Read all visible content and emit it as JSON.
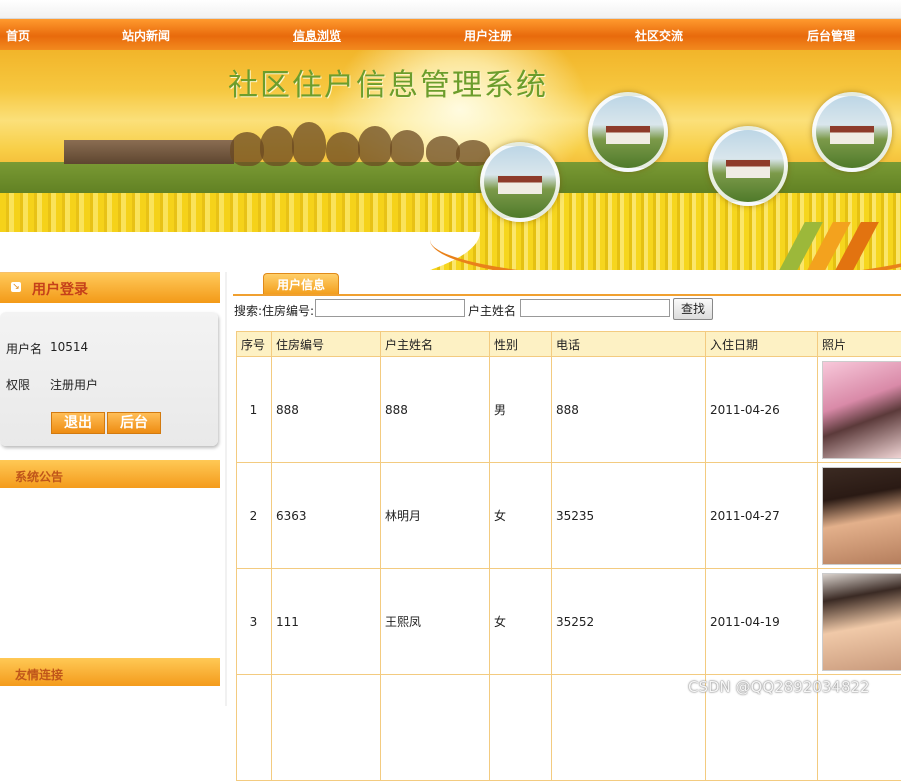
{
  "nav": [
    {
      "label": "首页"
    },
    {
      "label": "站内新闻"
    },
    {
      "label": "信息浏览",
      "active": true
    },
    {
      "label": "用户注册"
    },
    {
      "label": "社区交流"
    },
    {
      "label": "后台管理"
    }
  ],
  "banner": {
    "title": "社区住户信息管理系统"
  },
  "sidebar": {
    "login_title": "用户登录",
    "username_label": "用户名",
    "username_value": "10514",
    "role_label": "权限",
    "role_value": "注册用户",
    "logout_label": "退出",
    "admin_label": "后台",
    "notice_title": "系统公告",
    "links_title": "友情连接"
  },
  "main": {
    "tab_label": "用户信息",
    "search": {
      "label1": "搜索:住房编号:",
      "label2": "户主姓名",
      "button": "查找",
      "house_value": "",
      "name_value": ""
    },
    "table": {
      "headers": [
        "序号",
        "住房编号",
        "户主姓名",
        "性别",
        "电话",
        "入住日期",
        "照片"
      ],
      "rows": [
        [
          "1",
          "888",
          "888",
          "男",
          "888",
          "2011-04-26"
        ],
        [
          "2",
          "6363",
          "林明月",
          "女",
          "35235",
          "2011-04-27"
        ],
        [
          "3",
          "111",
          "王熙凤",
          "女",
          "35252",
          "2011-04-19"
        ]
      ]
    }
  },
  "watermark": "CSDN @QQ2892034822",
  "colors": {
    "accent": "#f0891a",
    "header_bg": "#fdf1c4",
    "grid_border": "#f3cb80",
    "title_green": "#6c9d2c"
  }
}
